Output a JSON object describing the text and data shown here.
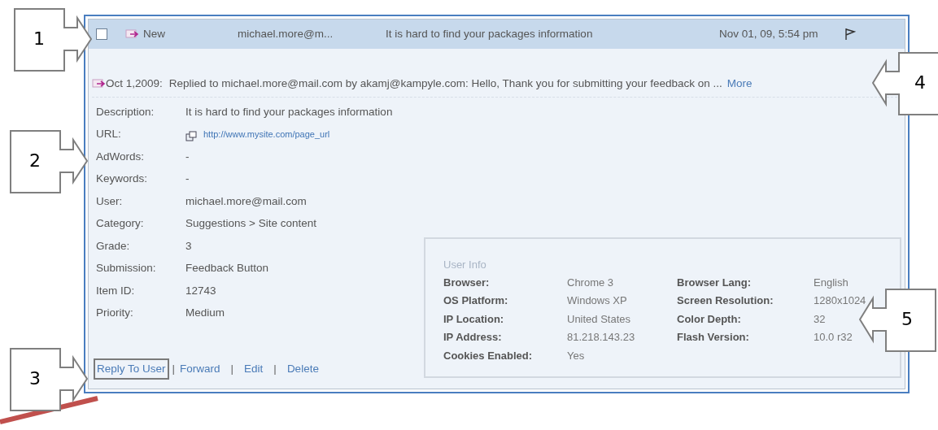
{
  "message": {
    "checked": false,
    "status": "New",
    "sender": "michael.more@m...",
    "subject": "It is hard to find your packages information",
    "date": "Nov 01, 09, 5:54 pm"
  },
  "reply": {
    "date": "Oct 1,2009:",
    "text": "Replied to michael.more@mail.com by akamj@kampyle.com: Hello, Thank you for submitting your feedback on ...",
    "more": "More"
  },
  "fields": [
    {
      "label": "Description:",
      "value": "It is hard to find your packages information",
      "kind": "text"
    },
    {
      "label": "URL:",
      "value": "http://www.mysite.com/page_url",
      "kind": "link"
    },
    {
      "label": "AdWords:",
      "value": "-",
      "kind": "text"
    },
    {
      "label": "Keywords:",
      "value": "-",
      "kind": "text"
    },
    {
      "label": "User:",
      "value": "michael.more@mail.com",
      "kind": "text"
    },
    {
      "label": "Category:",
      "value": "Suggestions > Site content",
      "kind": "text"
    },
    {
      "label": "Grade:",
      "value": "3",
      "kind": "text"
    },
    {
      "label": "Submission:",
      "value": "Feedback Button",
      "kind": "text"
    },
    {
      "label": "Item ID:",
      "value": "12743",
      "kind": "text"
    },
    {
      "label": "Priority:",
      "value": "Medium",
      "kind": "text"
    }
  ],
  "user_info": {
    "title": "User Info",
    "items": [
      {
        "label": "Browser:",
        "value": "Chrome 3"
      },
      {
        "label": "Browser Lang:",
        "value": "English"
      },
      {
        "label": "OS Platform:",
        "value": "Windows XP"
      },
      {
        "label": "Screen Resolution:",
        "value": "1280x1024"
      },
      {
        "label": "IP Location:",
        "value": "United States"
      },
      {
        "label": "Color Depth:",
        "value": "32"
      },
      {
        "label": "IP Address:",
        "value": "81.218.143.23"
      },
      {
        "label": "Flash Version:",
        "value": "10.0 r32"
      },
      {
        "label": "Cookies Enabled:",
        "value": "Yes"
      }
    ]
  },
  "actions": [
    {
      "label": "Reply To User",
      "highlighted": true
    },
    {
      "label": "Forward",
      "highlighted": false
    },
    {
      "label": "Edit",
      "highlighted": false
    },
    {
      "label": "Delete",
      "highlighted": false
    }
  ],
  "separator": "|",
  "callouts": [
    {
      "number": "1",
      "kind": "rightward"
    },
    {
      "number": "2",
      "kind": "rightward"
    },
    {
      "number": "3",
      "kind": "rightward"
    },
    {
      "number": "4",
      "kind": "leftward"
    },
    {
      "number": "5",
      "kind": "leftward"
    }
  ]
}
